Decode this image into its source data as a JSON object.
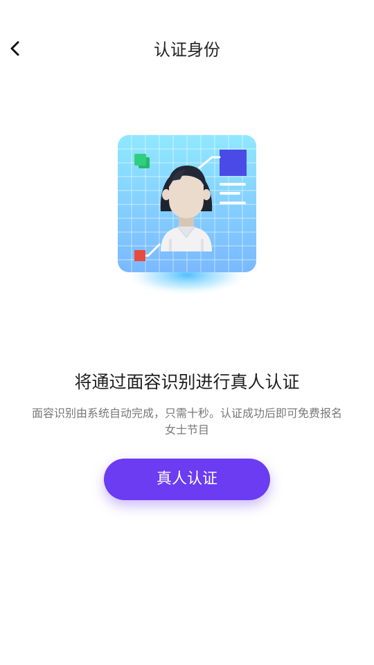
{
  "header": {
    "title": "认证身份",
    "back_icon": "chevron-left-icon"
  },
  "main": {
    "heading": "将通过面容识别进行真人认证",
    "description_line1": "面容识别由系统自动完成，只需十秒。认证成功后即可免费报名",
    "description_line2": "女士节目",
    "button_label": "真人认证"
  },
  "colors": {
    "accent": "#6b3cf2",
    "illustration_bg_top": "#8fe8ff",
    "illustration_bg_bottom": "#7ab8ff",
    "card_indigo": "#4a4be6",
    "green_square": "#2fcf7f",
    "red_square": "#e84b3c"
  }
}
